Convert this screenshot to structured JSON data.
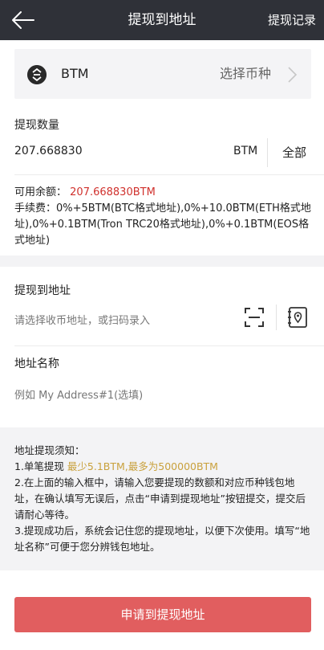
{
  "header": {
    "title": "提现到地址",
    "records_label": "提现记录"
  },
  "coin": {
    "name": "BTM",
    "select_label": "选择币种",
    "logo_icon": "btm-logo-icon"
  },
  "amount": {
    "label": "提现数量",
    "value": "207.668830",
    "unit": "BTM",
    "all_label": "全部"
  },
  "balance": {
    "label": "可用余额：",
    "value": "207.668830BTM"
  },
  "fee": {
    "text": "手续费：0%+5BTM(BTC格式地址),0%+10.0BTM(ETH格式地址),0%+0.1BTM(Tron TRC20格式地址),0%+0.1BTM(EOS格式地址)"
  },
  "address": {
    "label": "提现到地址",
    "placeholder": "请选择收币地址，或扫码录入"
  },
  "address_name": {
    "label": "地址名称",
    "placeholder": "例如 My Address#1(选填)"
  },
  "notice": {
    "title": "地址提现须知：",
    "line1_prefix": "1.单笔提现 ",
    "line1_highlight": "最少5.1BTM,最多为500000BTM",
    "line2": "2.在上面的输入框中，请输入您要提现的数额和对应币种钱包地址，在确认填写无误后，点击“申请到提现地址”按钮提交，提交后请耐心等待。",
    "line3": "3.提现成功后，系统会记住您的提现地址，以便下次使用。填写“地址名称”可便于您分辨钱包地址。"
  },
  "submit_label": "申请到提现地址",
  "colors": {
    "topbar": "#2f3138",
    "accent_red": "#d0312d",
    "button": "#e15e5f",
    "gold": "#c9a13d"
  }
}
